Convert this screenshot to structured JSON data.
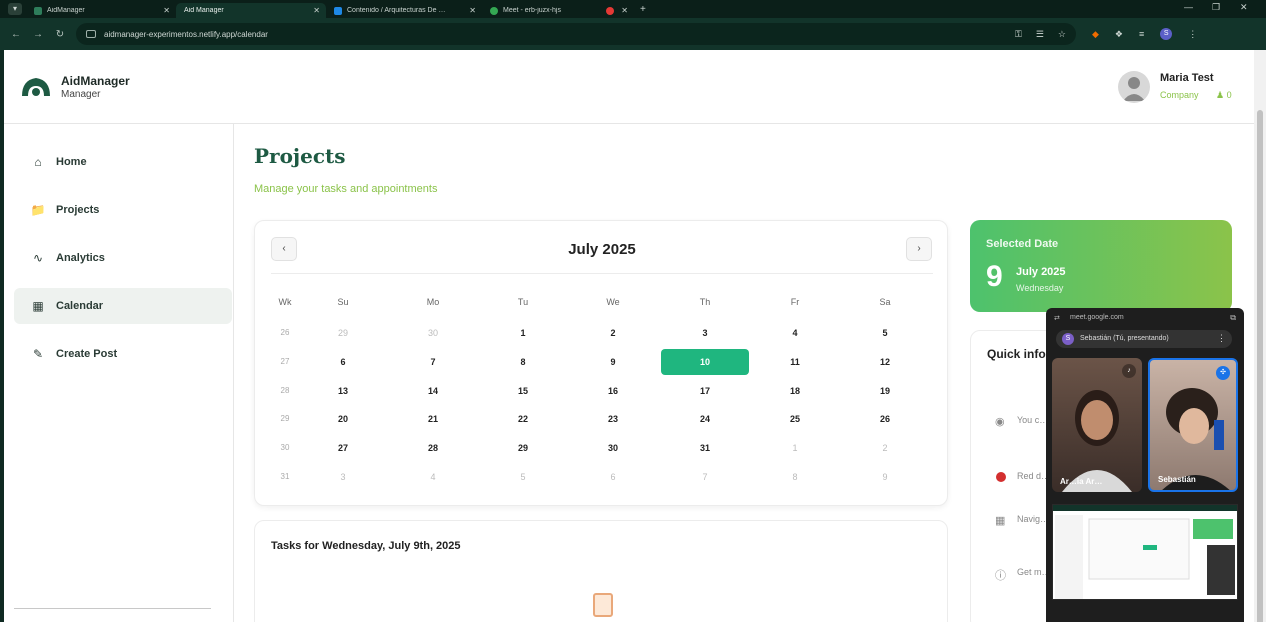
{
  "browser": {
    "tabs": [
      {
        "title": "AidManager",
        "active": false
      },
      {
        "title": "Aid Manager",
        "active": true
      },
      {
        "title": "Contenido / Arquitecturas De …",
        "active": false
      },
      {
        "title": "Meet - erb-juzx-hjs",
        "active": false
      },
      {
        "title": "",
        "active": false
      }
    ],
    "url": "aidmanager-experimentos.netlify.app/calendar"
  },
  "header": {
    "brand_name": "AidManager",
    "brand_sub": "Manager",
    "user_name": "Maria Test",
    "user_company": "Company",
    "user_count": "0"
  },
  "sidebar": {
    "items": [
      {
        "label": "Home",
        "icon": "home-icon"
      },
      {
        "label": "Projects",
        "icon": "folder-icon"
      },
      {
        "label": "Analytics",
        "icon": "chart-icon"
      },
      {
        "label": "Calendar",
        "icon": "calendar-icon",
        "active": true
      },
      {
        "label": "Create Post",
        "icon": "post-icon"
      }
    ]
  },
  "main": {
    "title": "Projects",
    "subtitle": "Manage your tasks and appointments"
  },
  "calendar": {
    "prev_label": "‹",
    "next_label": "›",
    "month_title": "July 2025",
    "headers": [
      "Wk",
      "Su",
      "Mo",
      "Tu",
      "We",
      "Th",
      "Fr",
      "Sa"
    ],
    "rows": [
      {
        "wk": "26",
        "days": [
          [
            "29",
            "o"
          ],
          [
            "30",
            "o"
          ],
          [
            "1",
            "c"
          ],
          [
            "2",
            "c"
          ],
          [
            "3",
            "c"
          ],
          [
            "4",
            "c"
          ],
          [
            "5",
            "c"
          ]
        ]
      },
      {
        "wk": "27",
        "days": [
          [
            "6",
            "c"
          ],
          [
            "7",
            "c"
          ],
          [
            "8",
            "c"
          ],
          [
            "9",
            "c"
          ],
          [
            "10",
            "s"
          ],
          [
            "11",
            "c"
          ],
          [
            "12",
            "c"
          ]
        ]
      },
      {
        "wk": "28",
        "days": [
          [
            "13",
            "c"
          ],
          [
            "14",
            "c"
          ],
          [
            "15",
            "c"
          ],
          [
            "16",
            "c"
          ],
          [
            "17",
            "c"
          ],
          [
            "18",
            "c"
          ],
          [
            "19",
            "c"
          ]
        ]
      },
      {
        "wk": "29",
        "days": [
          [
            "20",
            "c"
          ],
          [
            "21",
            "c"
          ],
          [
            "22",
            "c"
          ],
          [
            "23",
            "c"
          ],
          [
            "24",
            "c"
          ],
          [
            "25",
            "c"
          ],
          [
            "26",
            "c"
          ]
        ]
      },
      {
        "wk": "30",
        "days": [
          [
            "27",
            "c"
          ],
          [
            "28",
            "c"
          ],
          [
            "29",
            "c"
          ],
          [
            "30",
            "c"
          ],
          [
            "31",
            "c"
          ],
          [
            "1",
            "o"
          ],
          [
            "2",
            "o"
          ]
        ]
      },
      {
        "wk": "31",
        "days": [
          [
            "3",
            "o"
          ],
          [
            "4",
            "o"
          ],
          [
            "5",
            "o"
          ],
          [
            "6",
            "o"
          ],
          [
            "7",
            "o"
          ],
          [
            "8",
            "o"
          ],
          [
            "9",
            "o"
          ]
        ]
      }
    ]
  },
  "tasks": {
    "title": "Tasks for Wednesday, July 9th, 2025"
  },
  "selected_date": {
    "label": "Selected Date",
    "day": "9",
    "month_year": "July 2025",
    "weekday": "Wednesday"
  },
  "quick_info": {
    "title": "Quick info",
    "items": [
      {
        "icon": "eye-icon",
        "text": "You c… calen…"
      },
      {
        "icon": "red-dot",
        "text": "Red d…"
      },
      {
        "icon": "calendar-icon",
        "text": "Navig… tasks"
      },
      {
        "icon": "info-icon",
        "text": "Get m… differ…"
      }
    ]
  },
  "meet": {
    "url": "meet.google.com",
    "presenting": "Sebastián (Tú, presentando)",
    "avatar_letter": "S",
    "participants": [
      {
        "name": "Ar…ia Ar…"
      },
      {
        "name": "Sebastián"
      }
    ]
  }
}
